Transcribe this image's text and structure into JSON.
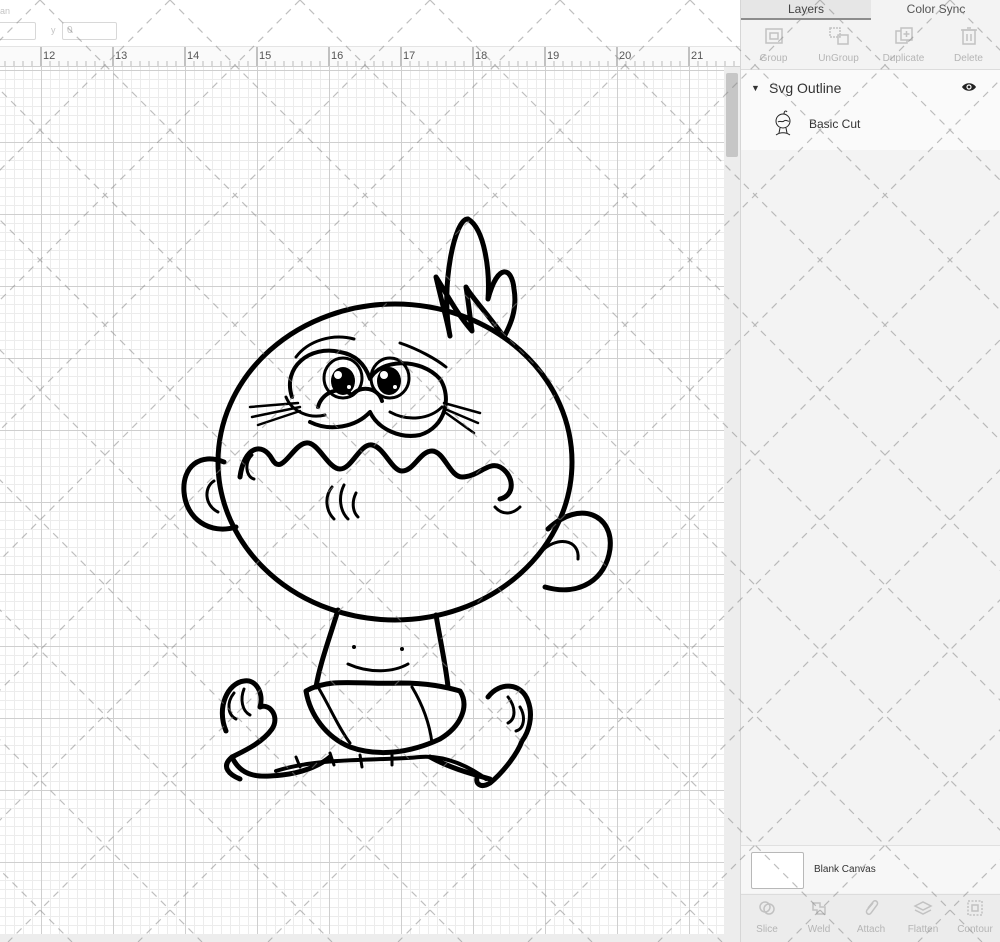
{
  "toolbar": {
    "field_y_label": "y",
    "field_y_value": "0",
    "field_left_value": "an"
  },
  "ruler": {
    "ticks": [
      "12",
      "13",
      "14",
      "15",
      "16",
      "17",
      "18",
      "19",
      "20",
      "21"
    ]
  },
  "panel": {
    "tabs": [
      {
        "label": "Layers",
        "active": true
      },
      {
        "label": "Color Sync",
        "active": false
      }
    ],
    "layer_tools": [
      {
        "label": "Group",
        "icon": "group-icon"
      },
      {
        "label": "UnGroup",
        "icon": "ungroup-icon"
      },
      {
        "label": "Duplicate",
        "icon": "duplicate-icon"
      },
      {
        "label": "Delete",
        "icon": "delete-icon"
      }
    ],
    "group": {
      "name": "Svg Outline",
      "visible_icon": "eye-icon"
    },
    "layer": {
      "name": "Basic Cut",
      "thumb_icon": "baby-thumbnail-icon"
    },
    "blank_canvas_label": "Blank Canvas",
    "bottom_tools": [
      {
        "label": "Slice",
        "icon": "slice-icon"
      },
      {
        "label": "Weld",
        "icon": "weld-icon"
      },
      {
        "label": "Attach",
        "icon": "attach-icon"
      },
      {
        "label": "Flatten",
        "icon": "flatten-icon"
      },
      {
        "label": "Contour",
        "icon": "contour-icon"
      }
    ]
  },
  "colors": {
    "grid_major": "#cfcfcf",
    "grid_minor": "#ececec",
    "panel_bg": "#f3f3f3",
    "artwork_stroke": "#000000",
    "disabled_text": "#b5b5b5"
  }
}
